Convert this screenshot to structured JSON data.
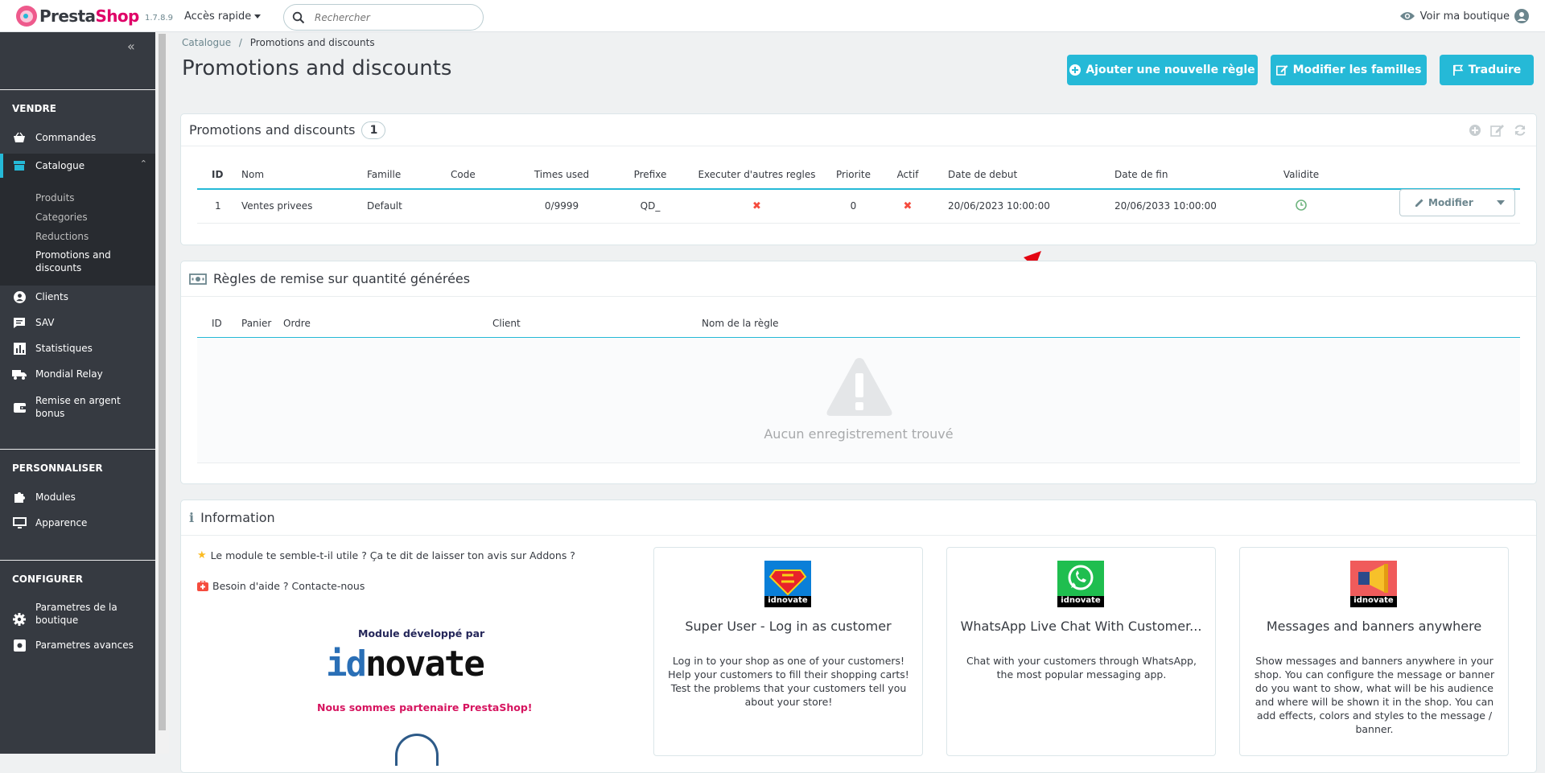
{
  "app": {
    "name_a": "Presta",
    "name_b": "Shop",
    "version": "1.7.8.9"
  },
  "topbar": {
    "quick_access": "Accès rapide",
    "search_placeholder": "Rechercher",
    "view_shop": "Voir ma boutique"
  },
  "sidebar": {
    "sections": [
      "VENDRE",
      "PERSONNALISER",
      "CONFIGURER"
    ],
    "sell_items": [
      "Commandes",
      "Catalogue"
    ],
    "catalogue_sub": [
      "Produits",
      "Categories",
      "Reductions",
      "Promotions and",
      "discounts"
    ],
    "more_items": [
      "Clients",
      "SAV",
      "Statistiques",
      "Mondial Relay"
    ],
    "remise": [
      "Remise en argent",
      "bonus"
    ],
    "custom_items": [
      "Modules",
      "Apparence"
    ],
    "config_params": [
      "Parametres de la",
      "boutique"
    ],
    "config_adv": "Parametres avances"
  },
  "breadcrumb": {
    "parent": "Catalogue",
    "sep": "/",
    "current": "Promotions and discounts"
  },
  "page": {
    "title": "Promotions and discounts"
  },
  "toolbar": {
    "add": "Ajouter une nouvelle règle",
    "families": "Modifier les familles",
    "translate": "Traduire"
  },
  "rules_panel": {
    "title": "Promotions and discounts",
    "count": "1",
    "columns": [
      "ID",
      "Nom",
      "Famille",
      "Code",
      "Times used",
      "Prefixe",
      "Executer d'autres regles",
      "Priorite",
      "Actif",
      "Date de debut",
      "Date de fin",
      "Validite"
    ],
    "row": {
      "id": "1",
      "nom": "Ventes privees",
      "famille": "Default",
      "code": "",
      "times_used": "0/9999",
      "prefixe": "QD_",
      "executer": "✖",
      "priorite": "0",
      "actif": "✖",
      "debut": "20/06/2023 10:00:00",
      "fin": "20/06/2033 10:00:00"
    },
    "edit_button": "Modifier"
  },
  "generated_panel": {
    "title": "Règles de remise sur quantité générées",
    "columns": [
      "ID",
      "Panier",
      "Ordre",
      "Client",
      "Nom de la règle"
    ],
    "empty": "Aucun enregistrement trouvé"
  },
  "info_panel": {
    "title": "Information",
    "review_link": "Le module te semble-t-il utile ? Ça te dit de laisser ton avis sur Addons ?",
    "help_link": "Besoin d'aide ? Contacte-nous",
    "developed_by": "Module développé par",
    "brand_a": "id",
    "brand_b": "novate",
    "partner": "Nous sommes partenaire PrestaShop!",
    "logo_caption": "idnovate",
    "cards": [
      {
        "title": "Super User - Log in as customer",
        "desc": "Log in to your shop as one of your customers! Help your customers to fill their shopping carts! Test the problems that your customers tell you about your store!"
      },
      {
        "title": "WhatsApp Live Chat With Customer...",
        "desc": "Chat with your customers through WhatsApp, the most popular messaging app."
      },
      {
        "title": "Messages and banners anywhere",
        "desc": "Show messages and banners anywhere in your shop. You can configure the message or banner do you want to show, what will be his audience and where will be shown it in the shop. You can add effects, colors and styles to the message / banner."
      }
    ]
  },
  "colors": {
    "primary": "#25b9d7",
    "sidebar": "#363a41",
    "danger": "#f54c3e",
    "success": "#70b580"
  }
}
